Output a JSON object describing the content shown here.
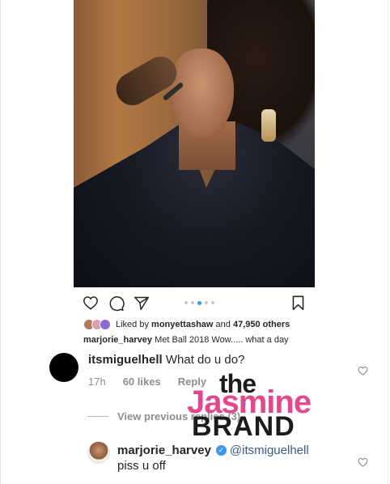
{
  "post": {
    "image_alt": "Woman in dark satin robe getting makeup done"
  },
  "carousel": {
    "total": 6,
    "active_index": 2
  },
  "likes": {
    "prefix": "Liked by",
    "user": "monyettashaw",
    "connector": "and",
    "others": "47,950 others"
  },
  "caption": {
    "username": "marjorie_harvey",
    "text": "Met Ball 2018 Wow..... what a day"
  },
  "comments": [
    {
      "username": "itsmiguelhell",
      "text": "What do u do?",
      "age": "17h",
      "likes": "60 likes",
      "reply_label": "Reply"
    }
  ],
  "view_previous_label": "View previous replies (3)",
  "reply": {
    "username": "marjorie_harvey",
    "mention": "@itsmiguelhell",
    "text": "piss u off"
  },
  "watermark": {
    "line1": "the",
    "line2": "Jasmine",
    "line3": "BRAND"
  },
  "colors": {
    "accent_blue": "#3897f0",
    "watermark_pink": "#e4478c",
    "muted_text": "#8e8e8e"
  },
  "icons": {
    "like": "heart-icon",
    "comment": "comment-bubble-icon",
    "share": "paper-plane-icon",
    "save": "bookmark-icon",
    "verified": "verified-badge-icon",
    "comment_like": "heart-outline-icon"
  }
}
